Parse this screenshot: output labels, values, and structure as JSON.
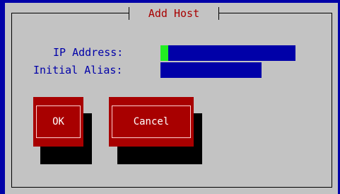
{
  "dialog": {
    "title": "Add Host"
  },
  "form": {
    "ip_address_label": "IP Address:",
    "initial_alias_label": "Initial Alias:",
    "ip_address_value": "",
    "initial_alias_value": ""
  },
  "buttons": {
    "ok_label": "OK",
    "cancel_label": "Cancel"
  },
  "colors": {
    "background": "#c3c3c3",
    "label_text": "#0000a8",
    "title_text": "#a80000",
    "entry_field": "#0000a8",
    "cursor": "#22ee22",
    "button": "#a80000",
    "button_shadow": "#000000"
  }
}
